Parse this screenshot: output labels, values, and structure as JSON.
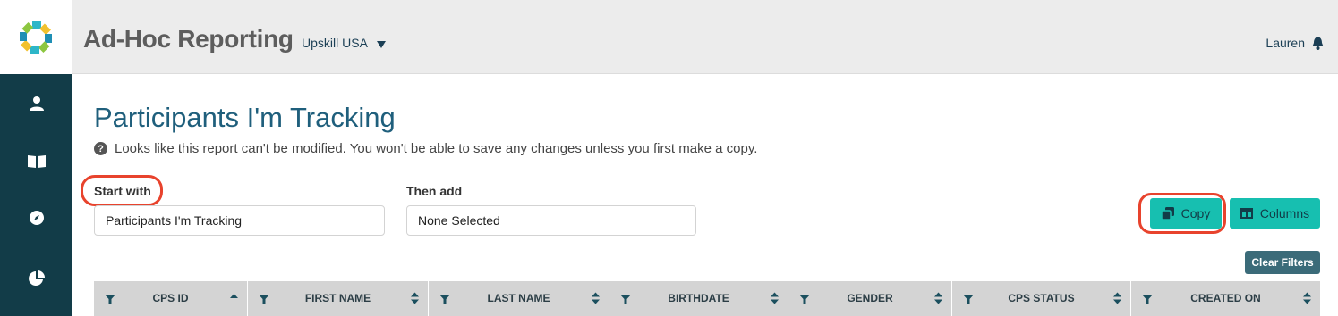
{
  "header": {
    "app_title": "Ad-Hoc Reporting",
    "org_name": "Upskill USA",
    "user_name": "Lauren"
  },
  "sidebar": {
    "items": [
      {
        "icon": "person-icon"
      },
      {
        "icon": "book-icon"
      },
      {
        "icon": "compass-icon"
      },
      {
        "icon": "pie-chart-icon"
      }
    ]
  },
  "main": {
    "title": "Participants I'm Tracking",
    "notice": "Looks like this report can't be modified. You won't be able to save any changes unless you first make a copy.",
    "start_with_label": "Start with",
    "start_with_value": "Participants I'm Tracking",
    "then_add_label": "Then add",
    "then_add_value": "None Selected",
    "copy_label": "Copy",
    "columns_label": "Columns",
    "clear_filters_label": "Clear Filters"
  },
  "table": {
    "columns": [
      {
        "label": "CPS ID",
        "sort": "asc"
      },
      {
        "label": "FIRST NAME",
        "sort": "both"
      },
      {
        "label": "LAST NAME",
        "sort": "both"
      },
      {
        "label": "BIRTHDATE",
        "sort": "both"
      },
      {
        "label": "GENDER",
        "sort": "both"
      },
      {
        "label": "CPS STATUS",
        "sort": "both"
      },
      {
        "label": "CREATED ON",
        "sort": "both"
      }
    ]
  },
  "colors": {
    "sidebar": "#123c48",
    "accent": "#17bfb0",
    "title": "#1f5f7c",
    "highlight": "#e8432d"
  }
}
